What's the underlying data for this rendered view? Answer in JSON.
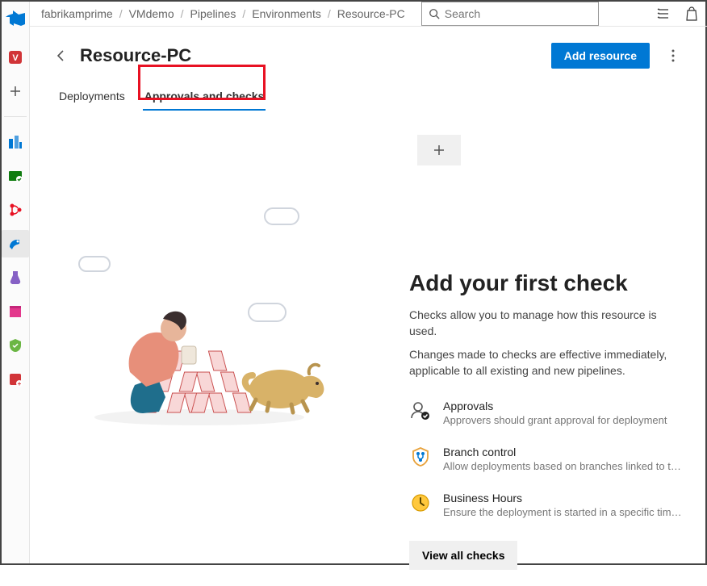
{
  "breadcrumbs": [
    "fabrikamprime",
    "VMdemo",
    "Pipelines",
    "Environments",
    "Resource-PC"
  ],
  "search_placeholder": "Search",
  "page_title": "Resource-PC",
  "add_button": "Add resource",
  "tabs": {
    "deployments": "Deployments",
    "approvals": "Approvals and checks"
  },
  "empty": {
    "title": "Add your first check",
    "line1": "Checks allow you to manage how this resource is used.",
    "line2": "Changes made to checks are effective immediately, applicable to all existing and new pipelines."
  },
  "checks": [
    {
      "name": "Approvals",
      "desc": "Approvers should grant approval for deployment",
      "icon": "approvals"
    },
    {
      "name": "Branch control",
      "desc": "Allow deployments based on branches linked to the run",
      "icon": "branch"
    },
    {
      "name": "Business Hours",
      "desc": "Ensure the deployment is started in a specific time win…",
      "icon": "hours"
    }
  ],
  "view_all": "View all checks",
  "nav_icons": [
    "project",
    "add",
    "boards",
    "repos",
    "pipelines-alt",
    "pipelines",
    "test",
    "artifacts",
    "compliance",
    "wiki"
  ]
}
